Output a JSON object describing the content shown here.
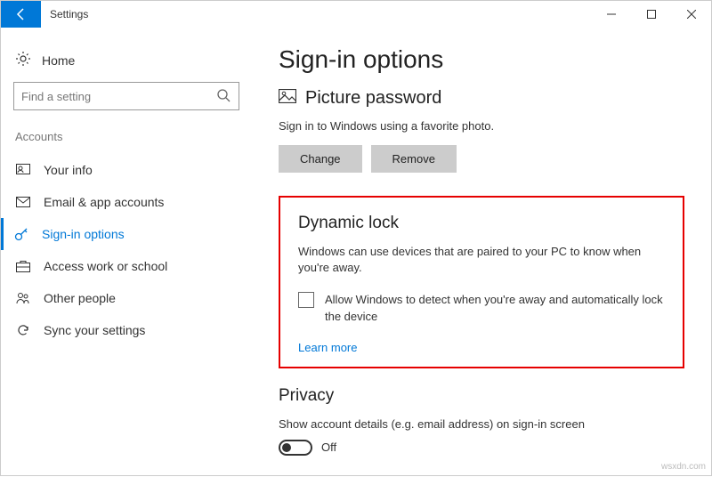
{
  "window": {
    "title": "Settings"
  },
  "sidebar": {
    "home": "Home",
    "search_placeholder": "Find a setting",
    "group": "Accounts",
    "items": [
      {
        "label": "Your info"
      },
      {
        "label": "Email & app accounts"
      },
      {
        "label": "Sign-in options"
      },
      {
        "label": "Access work or school"
      },
      {
        "label": "Other people"
      },
      {
        "label": "Sync your settings"
      }
    ]
  },
  "content": {
    "heading": "Sign-in options",
    "picture": {
      "heading": "Picture password",
      "desc": "Sign in to Windows using a favorite photo.",
      "change": "Change",
      "remove": "Remove"
    },
    "dynamic": {
      "heading": "Dynamic lock",
      "desc": "Windows can use devices that are paired to your PC to know when you're away.",
      "checkbox_label": "Allow Windows to detect when you're away and automatically lock the device",
      "learn_more": "Learn more"
    },
    "privacy": {
      "heading": "Privacy",
      "desc": "Show account details (e.g. email address) on sign-in screen",
      "toggle_state": "Off"
    }
  },
  "watermark": "wsxdn.com"
}
